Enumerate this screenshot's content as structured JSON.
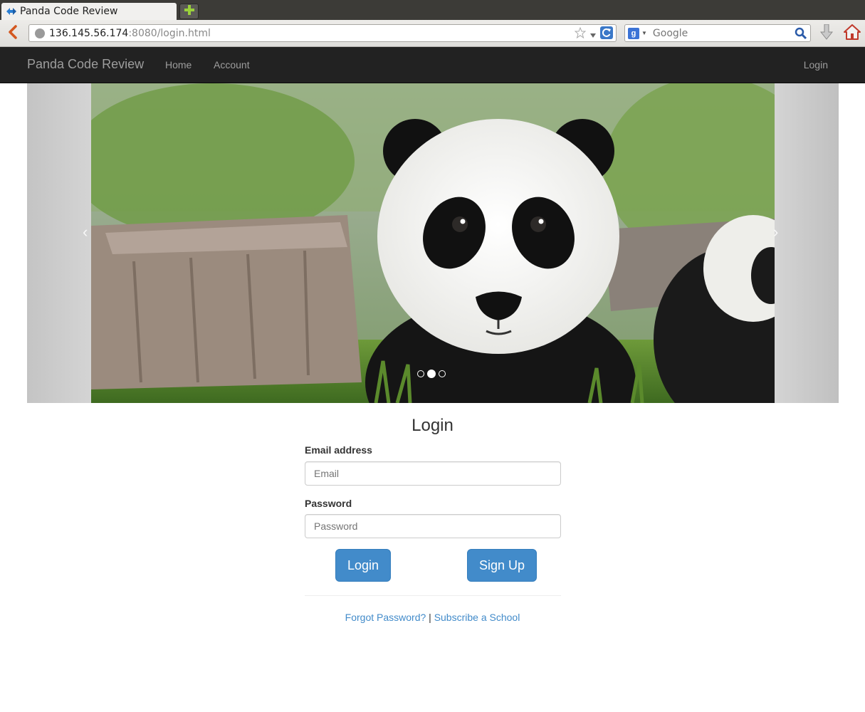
{
  "browser": {
    "tab_title": "Panda Code Review",
    "url_host": "136.145.56.174",
    "url_rest": ":8080/login.html",
    "search_placeholder": "Google",
    "search_engine_badge": "g"
  },
  "site_nav": {
    "brand": "Panda Code Review",
    "links": {
      "home": "Home",
      "account": "Account",
      "login": "Login"
    }
  },
  "carousel": {
    "image_alt": "Giant panda cub",
    "prev_icon": "‹",
    "next_icon": "›",
    "slide_count": 3,
    "active_index": 1
  },
  "login_form": {
    "title": "Login",
    "email_label": "Email address",
    "email_placeholder": "Email",
    "password_label": "Password",
    "password_placeholder": "Password",
    "login_button": "Login",
    "signup_button": "Sign Up",
    "forgot_link": "Forgot Password?",
    "separator": "|",
    "subscribe_link": "Subscribe a School"
  },
  "colors": {
    "navbar_bg": "#222222",
    "primary": "#428bca",
    "link": "#428bca"
  }
}
